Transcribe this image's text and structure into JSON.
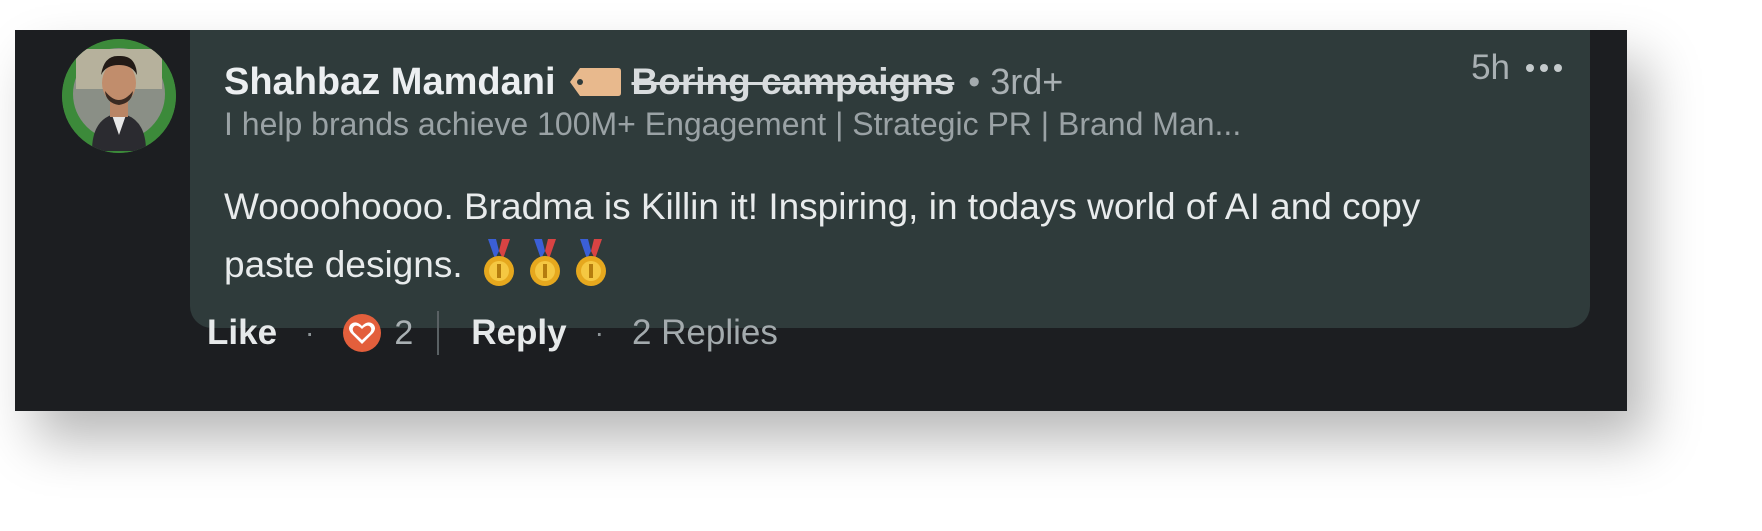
{
  "comment": {
    "author_name": "Shahbaz Mamdani",
    "label": "Boring campaigns",
    "separator": "•",
    "degree": "3rd+",
    "timestamp": "5h",
    "headline": "I help brands achieve 100M+ Engagement | Strategic PR | Brand Man...",
    "text": "Woooohoooo. Bradma is Killin it! Inspiring, in todays world of AI and copy paste designs.",
    "emoji_count": 3,
    "emoji_icon": "first-place-medal-icon"
  },
  "actions": {
    "like_label": "Like",
    "dot": "·",
    "reaction_icon": "love-reaction-icon",
    "reaction_count": "2",
    "reply_label": "Reply",
    "replies_label": "2 Replies"
  },
  "colors": {
    "background": "#1c1e21",
    "bubble": "#2f3b3b",
    "avatar_ring": "#3c8a3a",
    "reaction": "#e35f3c"
  }
}
